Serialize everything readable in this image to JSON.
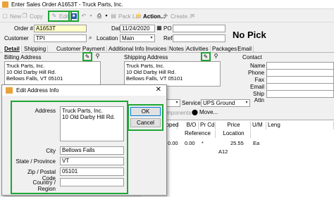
{
  "window": {
    "title": "Enter Sales Order A1653T - Truck Parts, Inc."
  },
  "toolbar": {
    "new": "New",
    "copy": "Copy",
    "edit": "Edit",
    "pack_list": "Pack List",
    "actions": "Action...",
    "create": "Create..."
  },
  "header": {
    "order_label": "Order #",
    "order_value": "A1653T",
    "date_label": "Date",
    "date_value": "11/24/2020",
    "po_label": "PO",
    "po_value": "",
    "customer_label": "Customer",
    "customer_value": "TPI",
    "location_label": "Location",
    "location_value": "Main",
    "ref_label": "Ref",
    "ref_value": "",
    "status": "No Pick"
  },
  "tabs": [
    "Detail",
    "Shipping",
    "Customer",
    "Payment",
    "Additional Info",
    "Invoices",
    "Notes",
    "Activities",
    "Packages",
    "Email"
  ],
  "billing": {
    "label": "Billing Address",
    "lines": [
      "Truck Parts, Inc.",
      "10 Old Darby Hill Rd.",
      "Bellows Falls, VT 05101"
    ]
  },
  "shipping": {
    "label": "Shipping Address",
    "lines": [
      "Truck Parts, Inc.",
      "10 Old Darby Hill Rd.",
      "Bellows Falls, VT 05101"
    ]
  },
  "contact": {
    "contact_label": "Contact",
    "name_label": "Name",
    "phone_label": "Phone",
    "fax_label": "Fax",
    "email_label": "Email",
    "ship_attn_label": "Ship Attn"
  },
  "service": {
    "label": "Service",
    "value": "UPS Ground"
  },
  "components": {
    "label": "Components",
    "move": "Move..."
  },
  "grid": {
    "headers": [
      "Shipped",
      "B/O",
      "Pr Cd",
      "Price",
      "U/M",
      "Leng"
    ],
    "row2_headers": [
      "Reference",
      "Location"
    ],
    "rows": [
      {
        "shipped": "0.00",
        "bo": "0.00",
        "prcd": "*",
        "price": "25.55",
        "um": "Ea"
      },
      {
        "location": "A12"
      }
    ]
  },
  "dialog": {
    "title": "Edit Address Info",
    "address_label": "Address",
    "address_lines": [
      "Truck Parts, Inc.",
      "10 Old Darby Hill Rd."
    ],
    "city_label": "City",
    "city_value": "Bellows Falls",
    "state_label": "State / Province",
    "state_value": "VT",
    "zip_label": "Zip / Postal Code",
    "zip_value": "05101",
    "country_label": "Country / Region",
    "country_value": "",
    "ok": "OK",
    "cancel": "Cancel"
  },
  "colors": {
    "highlight": "#1ea534",
    "window_bg": "#f0f0f0",
    "required_field": "#ffffcc"
  }
}
